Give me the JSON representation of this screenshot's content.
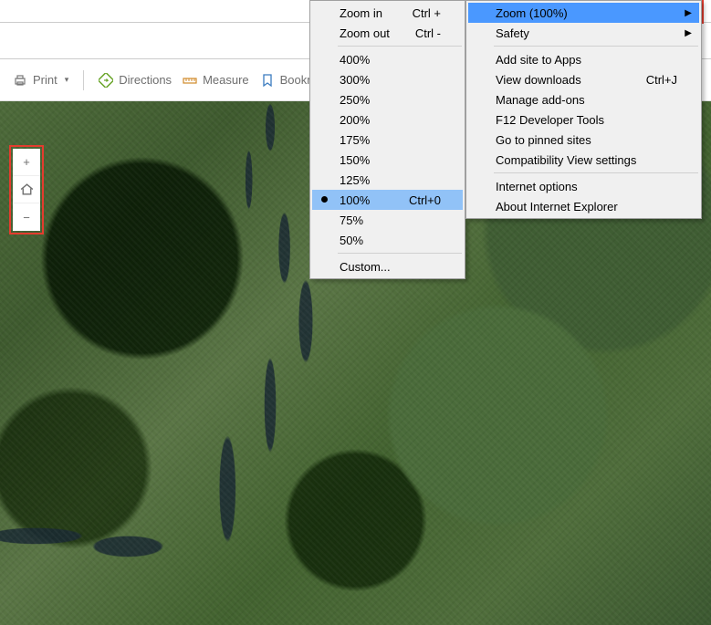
{
  "toolbar": {
    "print_label": "Print",
    "directions_label": "Directions",
    "measure_label": "Measure",
    "bookmark_label": "Bookm"
  },
  "zoom_widget": {
    "plus": "+",
    "minus": "−"
  },
  "submenu": {
    "zoom_in": {
      "label": "Zoom in",
      "shortcut": "Ctrl +"
    },
    "zoom_out": {
      "label": "Zoom out",
      "shortcut": "Ctrl -"
    },
    "levels": [
      "400%",
      "300%",
      "250%",
      "200%",
      "175%",
      "150%",
      "125%",
      "100%",
      "75%",
      "50%"
    ],
    "current_level_index": 7,
    "current_shortcut": "Ctrl+0",
    "custom_label": "Custom..."
  },
  "main_menu": {
    "zoom": {
      "label": "Zoom (100%)",
      "has_submenu": true
    },
    "safety": {
      "label": "Safety",
      "has_submenu": true
    },
    "add_site": "Add site to Apps",
    "view_dl": {
      "label": "View downloads",
      "shortcut": "Ctrl+J"
    },
    "manage_addons": "Manage add-ons",
    "f12": "F12 Developer Tools",
    "pinned": "Go to pinned sites",
    "compat": "Compatibility View settings",
    "inet_opts": "Internet options",
    "about": "About Internet Explorer"
  },
  "colors": {
    "highlight_red": "#e43c2e",
    "menu_highlight": "#4a98ff"
  }
}
